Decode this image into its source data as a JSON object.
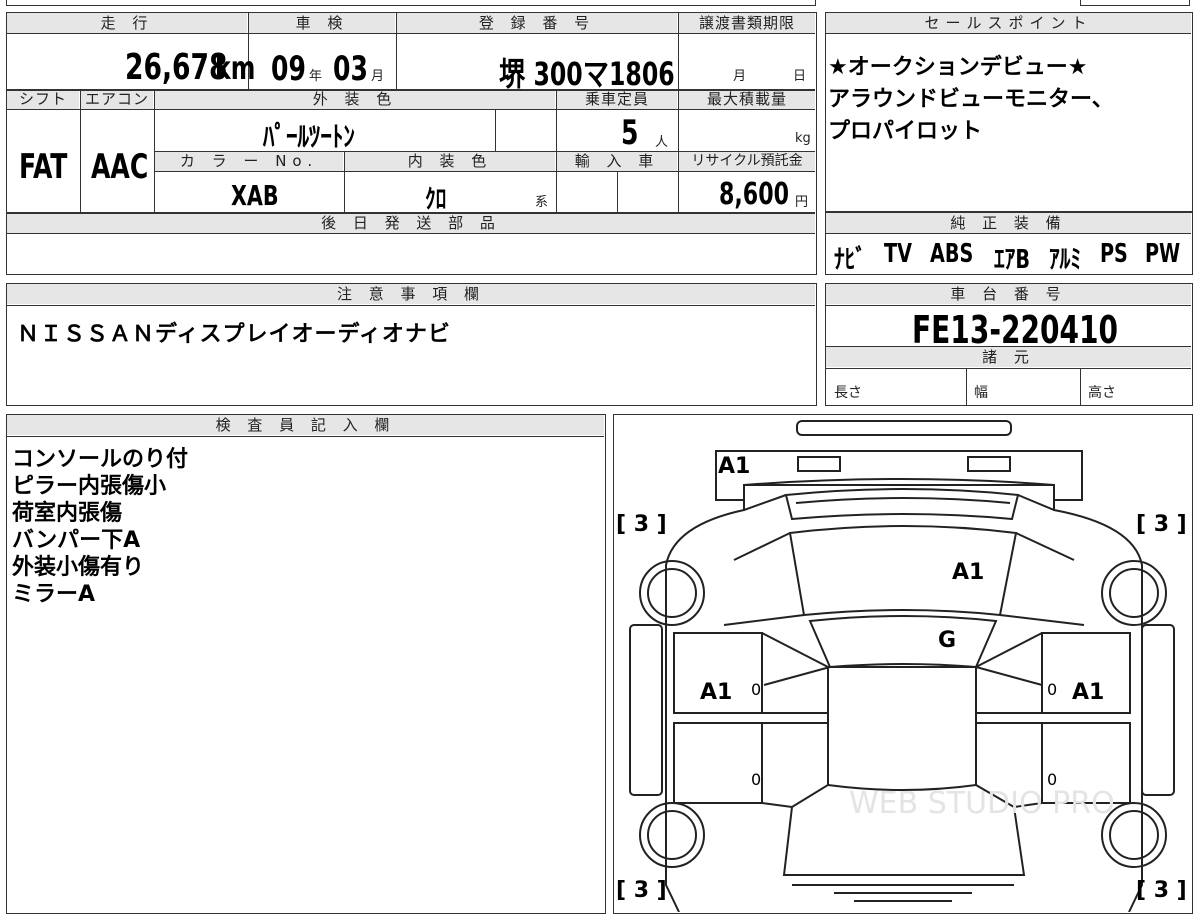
{
  "headers": {
    "mileage": "走 行",
    "shaken": "車 検",
    "registration": "登 録 番 号",
    "doc_deadline": "譲渡書類期限",
    "sales_points": "セールスポイント",
    "shift": "シフト",
    "aircon": "エアコン",
    "exterior_color": "外 装 色",
    "capacity": "乗車定員",
    "max_load": "最大積載量",
    "color_no": "カ ラ ー No.",
    "interior_color": "内 装 色",
    "import": "輸 入 車",
    "recycle": "リサイクル預託金",
    "later_parts": "後 日 発 送 部 品",
    "genuine_equipment": "純 正 装 備",
    "notes": "注 意 事 項 欄",
    "chassis_no": "車 台 番 号",
    "specs": "諸 元",
    "inspector": "検 査 員 記 入 欄"
  },
  "values": {
    "mileage": "26,678",
    "mileage_unit": "km",
    "shaken_year": "09",
    "shaken_year_unit": "年",
    "shaken_month": "03",
    "shaken_month_unit": "月",
    "registration": "堺 300マ1806",
    "deadline_month_unit": "月",
    "deadline_day_unit": "日",
    "shift": "FAT",
    "aircon": "AAC",
    "exterior_color": "ﾊﾟｰﾙﾂｰﾄﾝ",
    "capacity": "5",
    "capacity_unit": "人",
    "max_load_unit": "kg",
    "color_no": "XAB",
    "interior_color": "ｸﾛ",
    "interior_suffix": "系",
    "recycle_fee": "8,600",
    "recycle_unit": "円",
    "chassis_no": "FE13-220410",
    "spec_length": "長さ",
    "spec_width": "幅",
    "spec_height": "高さ"
  },
  "sales_points": [
    "★オークションデビュー★",
    "アラウンドビューモニター、",
    "プロパイロット"
  ],
  "equipment": [
    "ﾅﾋﾞ",
    "TV",
    "ABS",
    "ｴｱB",
    "ｱﾙﾐ",
    "PS",
    "PW"
  ],
  "notes_text": "ＮＩＳＳＡＮディスプレイオーディオナビ",
  "inspector_lines": [
    "コンソールのり付",
    "ピラー内張傷小",
    "荷室内張傷",
    "バンパー下A",
    "外装小傷有り",
    "ミラーA"
  ],
  "diagram_marks": {
    "rear_bumper": "A1",
    "roof": "A1",
    "windshield": "G",
    "left_door": "A1",
    "right_door": "A1",
    "tire_fl": "[ 3 ]",
    "tire_fr": "[ 3 ]",
    "tire_rl": "[ 3 ]",
    "tire_rr": "[ 3 ]",
    "door_zero": "0"
  },
  "watermark": "WEB STUDIO PRO"
}
